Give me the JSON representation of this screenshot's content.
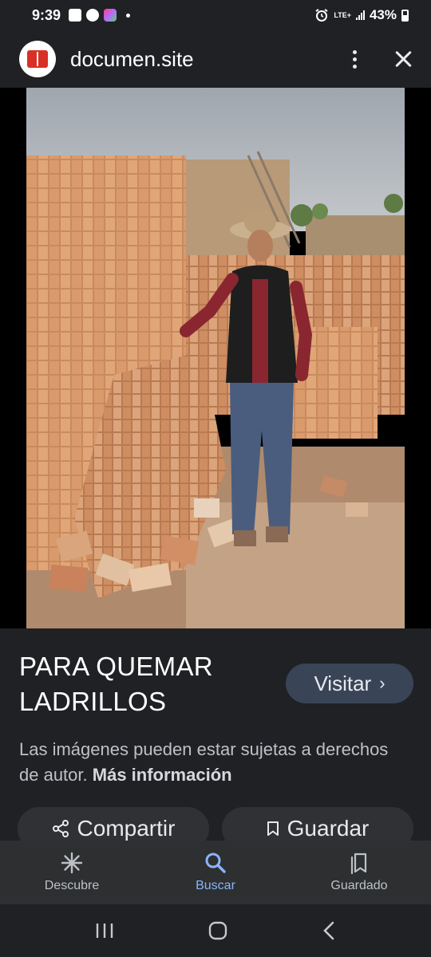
{
  "status_bar": {
    "time": "9:39",
    "network_label": "LTE+",
    "battery_text": "43%"
  },
  "header": {
    "site_name": "documen.site"
  },
  "image": {
    "title": "PARA QUEMAR LADRILLOS",
    "visit_label": "Visitar",
    "copyright_text": "Las imágenes pueden estar sujetas a derechos de autor.",
    "more_info_label": "Más información"
  },
  "actions": {
    "share_label": "Compartir",
    "save_label": "Guardar"
  },
  "bottom_nav": {
    "items": [
      {
        "label": "Descubre",
        "icon": "asterisk-icon"
      },
      {
        "label": "Buscar",
        "icon": "search-icon",
        "active": true
      },
      {
        "label": "Guardado",
        "icon": "collections-icon"
      }
    ]
  },
  "colors": {
    "background": "#202124",
    "accent": "#8ab4f8",
    "visit_button": "#394457"
  }
}
